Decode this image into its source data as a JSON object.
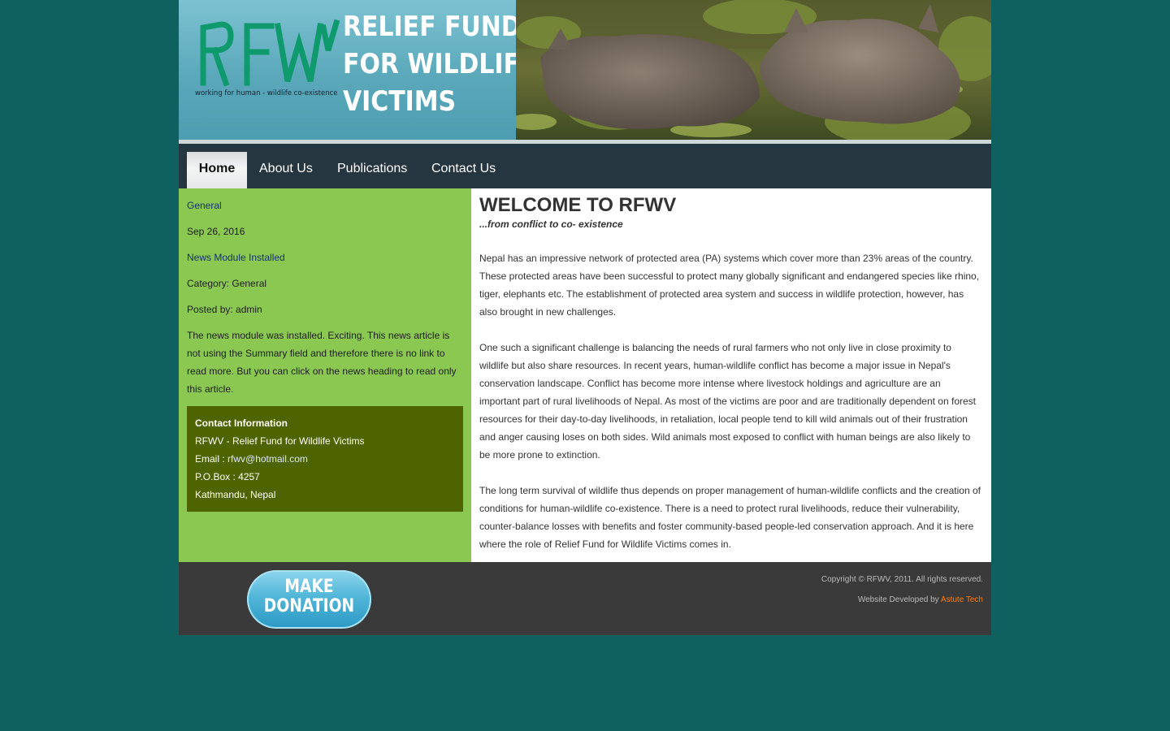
{
  "header": {
    "logo_text": "RFWV",
    "tagline": "working for human - wildlife co-existence",
    "title_lines": [
      "RELIEF FUND",
      "FOR WILDLIFE",
      "VICTIMS"
    ]
  },
  "nav": {
    "items": [
      {
        "label": "Home",
        "active": true
      },
      {
        "label": "About Us"
      },
      {
        "label": "Publications"
      },
      {
        "label": "Contact Us"
      }
    ]
  },
  "news": {
    "category_link": "General",
    "date": "Sep 26, 2016",
    "headline": "News Module Installed",
    "category": "Category: General",
    "posted_by": "Posted by: admin",
    "body": "The news module was installed. Exciting. This news article is not using the Summary field and therefore there is no link to read more. But you can click on the news heading to read only this article."
  },
  "contact": {
    "heading": "Contact Information",
    "org": "RFWV - Relief Fund for Wildlife Victims",
    "email_label": "Email : ",
    "email": "rfwv@hotmail.com",
    "pobox": "P.O.Box : 4257",
    "city": "Kathmandu, Nepal"
  },
  "main": {
    "heading": "WELCOME TO RFWV",
    "subheading": "...from conflict to co- existence",
    "paragraphs": [
      "Nepal has an impressive network of protected area (PA) systems which cover more than 23% areas of the country. These protected areas have been successful to protect many globally significant and endangered species like rhino, tiger, elephants etc. The establishment of protected area system and success in wildlife protection, however, has also brought in new challenges.",
      "One such a significant challenge is balancing the needs of rural farmers who not only live in close proximity to wildlife but also share resources. In recent years, human-wildlife conflict has become a major issue in Nepal's conservation landscape. Conflict has become more intense where livestock holdings and agriculture are an important part of rural livelihoods of Nepal. As most of the victims are poor and are traditionally dependent on forest resources for their day-to-day livelihoods, in retaliation, local people tend to kill wild animals out of their frustration and anger causing loses on both sides. Wild animals most exposed to conflict with human beings are also likely to be more prone to extinction.",
      "The long term survival of wildlife thus depends on proper management of human-wildlife conflicts and the creation of conditions for human-wildlife co-existence. There is a need to protect rural livelihoods, reduce their vulnerability, counter-balance losses with benefits and foster community-based people-led conservation approach. And it is here where the role of Relief Fund for Wildlife Victims comes in."
    ]
  },
  "footer": {
    "donate_line1": "MAKE",
    "donate_line2": "DONATION",
    "copyright": "Copyright © RFWV, 2011. All rights reserved.",
    "developed_prefix": "Website Developed by ",
    "developer": "Astute Tech"
  },
  "colors": {
    "page_bg": "#0f615f",
    "nav_bg": "#263640",
    "sidebar_bg": "#8bc852",
    "contact_bg": "#4e6400",
    "logo_green": "#0f9a6e",
    "footer_bg": "#3a3a3a",
    "developer_link": "#ff7b00"
  }
}
